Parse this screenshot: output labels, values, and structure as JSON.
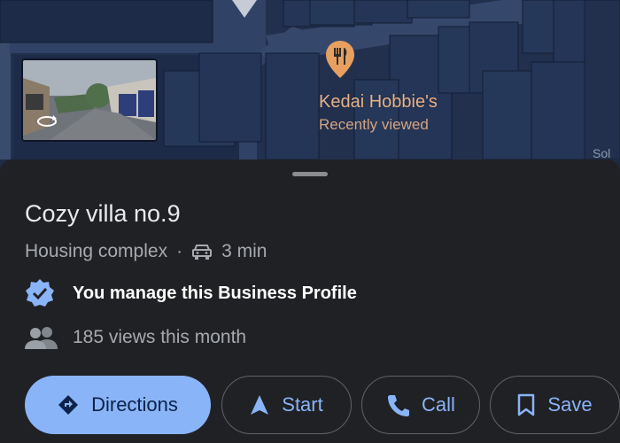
{
  "map": {
    "poi": {
      "name": "Kedai Hobbie's",
      "subtitle": "Recently viewed",
      "icon": "restaurant-icon",
      "pin_color": "#e8a060"
    },
    "edge_label": "Sol",
    "street_view_icon": "rotate-360-icon"
  },
  "place": {
    "title": "Cozy villa no.9",
    "category": "Housing complex",
    "separator": "·",
    "travel_mode_icon": "car-icon",
    "travel_time": "3 min",
    "verified_text": "You manage this Business Profile",
    "views_text": "185 views this month"
  },
  "actions": {
    "directions": "Directions",
    "start": "Start",
    "call": "Call",
    "save": "Save"
  },
  "colors": {
    "accent": "#8ab4f8",
    "sheet_bg": "#202124",
    "map_bg": "#20304f"
  }
}
